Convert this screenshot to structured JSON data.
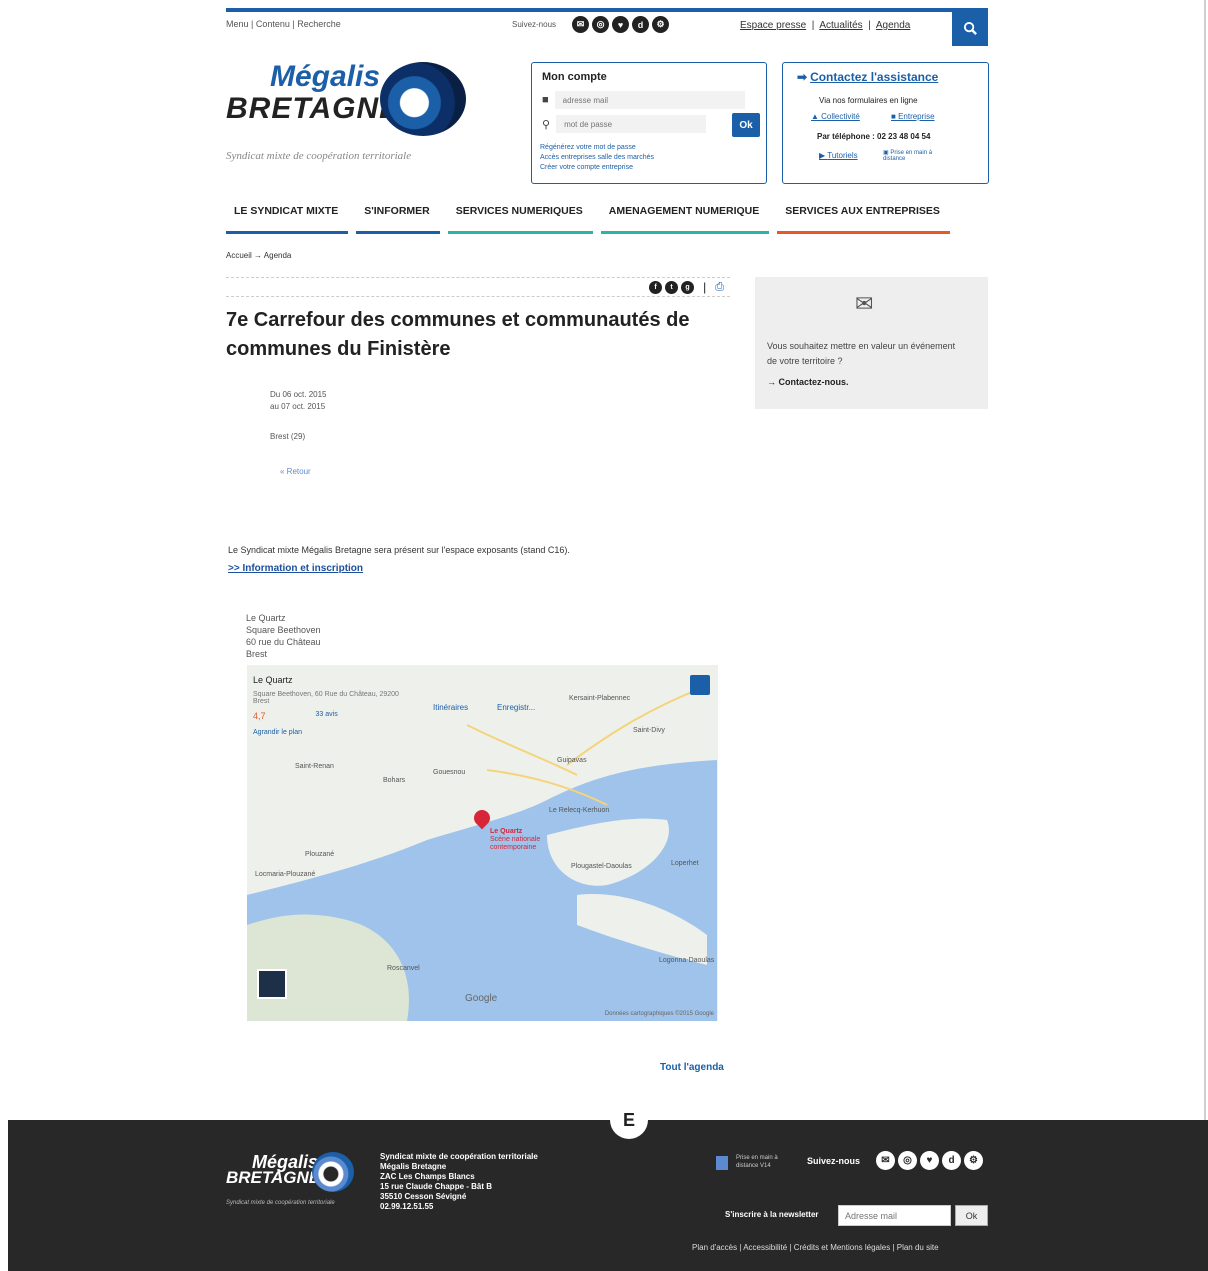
{
  "top": {
    "nav": "Menu | Contenu | Recherche",
    "subscribe": "Suivez-nous",
    "social_top": [
      "✉",
      "◎",
      "♥",
      "d",
      "⚙"
    ],
    "links": [
      "Espace presse",
      "Actualités",
      "Agenda"
    ],
    "search_icon": "search-icon"
  },
  "logo": {
    "line1": "Mégalis",
    "line2": "BRETAGNE",
    "tagline": "Syndicat mixte de coopération territoriale"
  },
  "account": {
    "title": "Mon compte",
    "email_placeholder": "adresse mail",
    "password_placeholder": "mot de passe",
    "ok": "Ok",
    "links": [
      "Régénérez votre mot de passe",
      "Accès entreprises salle des marchés",
      "Créer votre compte entreprise"
    ]
  },
  "assist": {
    "title": "Contactez l'assistance",
    "via": "Via nos formulaires en ligne",
    "collectivite": "Collectivité",
    "entreprise": "Entreprise",
    "phone": "Par téléphone : 02 23 48 04 54",
    "tutorials": "Tutoriels",
    "remote": "Prise en main à distance"
  },
  "mainnav": [
    {
      "label": "LE SYNDICAT MIXTE",
      "color": "#1b5fa8"
    },
    {
      "label": "S'INFORMER",
      "color": "#1b5fa8"
    },
    {
      "label": "SERVICES NUMERIQUES",
      "color": "#2bb5a8"
    },
    {
      "label": "AMENAGEMENT NUMERIQUE",
      "color": "#2bb5a8"
    },
    {
      "label": "SERVICES AUX ENTREPRISES",
      "color": "#e8572a"
    }
  ],
  "breadcrumb": "Accueil → Agenda",
  "article": {
    "title": "7e Carrefour des communes et communautés de communes du Finistère",
    "date_from": "Du 06 oct. 2015",
    "date_to": "au 07 oct. 2015",
    "location": "Brest (29)",
    "back": "« Retour",
    "body": "Le Syndicat mixte Mégalis Bretagne sera présent sur l'espace exposants (stand C16).",
    "info_link": ">> Information et inscription",
    "address": [
      "Le Quartz",
      "Square Beethoven",
      "60 rue du Château",
      "Brest"
    ],
    "tout_agenda": "Tout l'agenda"
  },
  "map": {
    "place_name": "Le Quartz",
    "place_address": "Square Beethoven, 60 Rue du Château, 29200 Brest",
    "rating": "4,7",
    "reviews": "33 avis",
    "directions": "Itinéraires",
    "save": "Enregistr...",
    "bigger_map": "Agrandir le plan",
    "pin_label": "Le Quartz",
    "pin_sub": "Scène nationale contemporaine",
    "places": [
      "Kersaint-Plabennec",
      "Saint-Divy",
      "Guipavas",
      "Le Relecq-Kerhuon",
      "Plougastel-Daoulas",
      "Loperhet",
      "Plouzané",
      "Locmaria-Plouzané",
      "Bohars",
      "Gouesnou",
      "Saint-Renan",
      "Roscanvel",
      "Logonna-Daoulas"
    ],
    "google": "Google",
    "attrib": "Données cartographiques ©2015 Google"
  },
  "sidebar": {
    "text": "Vous souhaitez mettre en valeur un événement de votre territoire ?",
    "cta": "→ Contactez-nous."
  },
  "footer": {
    "badge": "E",
    "logo1": "Mégalis",
    "logo2": "BRETAGNE",
    "tagline": "Syndicat mixte de coopération territoriale",
    "address": [
      "Syndicat mixte de coopération territoriale",
      "Mégalis Bretagne",
      "ZAC Les Champs Blancs",
      "15 rue Claude Chappe - Bât B",
      "35510 Cesson Sévigné",
      "02.99.12.51.55"
    ],
    "remote": "Prise en main à distance V14",
    "follow": "Suivez-nous",
    "newsletter": "S'inscrire à la newsletter",
    "newsletter_placeholder": "Adresse mail",
    "ok": "Ok",
    "links": "Plan d'accès | Accessibilité | Crédits et Mentions légales | Plan du site"
  }
}
